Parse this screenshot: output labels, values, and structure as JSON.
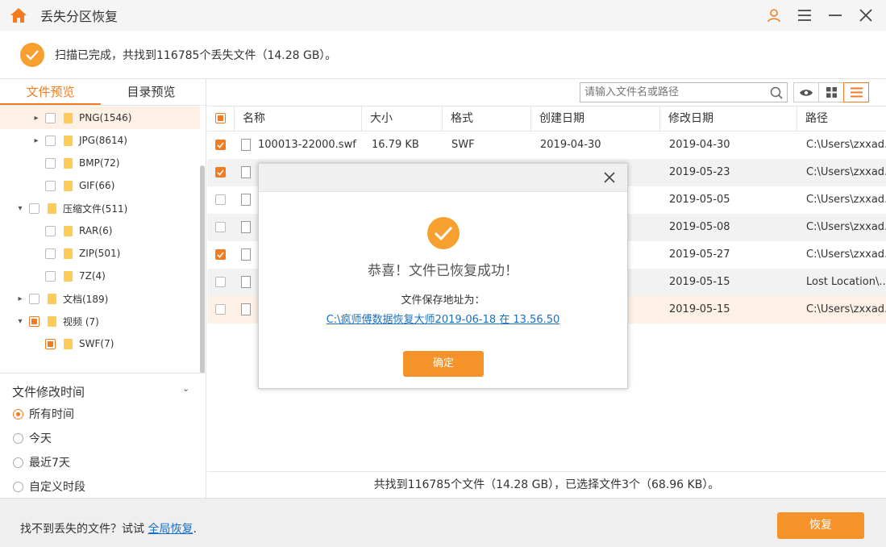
{
  "app": {
    "title": "丢失分区恢复"
  },
  "status": {
    "message": "扫描已完成，共找到116785个丢失文件（14.28 GB）。"
  },
  "left": {
    "tabs": [
      "文件预览",
      "目录预览"
    ],
    "tree": [
      {
        "label": "PNG(1546)"
      },
      {
        "label": "JPG(8614)"
      },
      {
        "label": "BMP(72)"
      },
      {
        "label": "GIF(66)"
      },
      {
        "label": "压缩文件(511)"
      },
      {
        "label": "RAR(6)"
      },
      {
        "label": "ZIP(501)"
      },
      {
        "label": "7Z(4)"
      },
      {
        "label": "文档(189)"
      },
      {
        "label": "视频 (7)"
      },
      {
        "label": "SWF(7)"
      }
    ],
    "filter": {
      "title": "文件修改时间",
      "options": [
        "所有时间",
        "今天",
        "最近7天",
        "自定义时段"
      ],
      "selected": "所有时间"
    }
  },
  "search": {
    "placeholder": "请输入文件名或路径"
  },
  "table": {
    "headers": [
      "名称",
      "大小",
      "格式",
      "创建日期",
      "修改日期",
      "路径"
    ],
    "rows": [
      {
        "name": "100013-22000.swf",
        "size": "16.79 KB",
        "format": "SWF",
        "created": "2019-04-30",
        "modified": "2019-04-30",
        "path": "C:\\Users\\zxxad...",
        "checked": true
      },
      {
        "name": "",
        "size": "",
        "format": "",
        "created": "",
        "modified": "2019-05-23",
        "path": "C:\\Users\\zxxad...",
        "checked": true
      },
      {
        "name": "",
        "size": "",
        "format": "",
        "created": "",
        "modified": "2019-05-05",
        "path": "C:\\Users\\zxxad...",
        "checked": false
      },
      {
        "name": "",
        "size": "",
        "format": "",
        "created": "",
        "modified": "2019-05-08",
        "path": "C:\\Users\\zxxad...",
        "checked": false
      },
      {
        "name": "",
        "size": "",
        "format": "",
        "created": "",
        "modified": "2019-05-27",
        "path": "C:\\Users\\zxxad...",
        "checked": true
      },
      {
        "name": "",
        "size": "",
        "format": "",
        "created": "",
        "modified": "2019-05-15",
        "path": "Lost Location\\...",
        "checked": false
      },
      {
        "name": "",
        "size": "",
        "format": "",
        "created": "",
        "modified": "2019-05-15",
        "path": "C:\\Users\\zxxad...",
        "checked": false
      }
    ],
    "footer": "共找到116785个文件（14.28 GB），已选择文件3个（68.96 KB）。"
  },
  "bottom": {
    "hint_prefix": "找不到丢失的文件？试试 ",
    "hint_link": "全局恢复",
    "hint_suffix": ".",
    "recover_label": "恢复"
  },
  "modal": {
    "congrats": "恭喜！文件已恢复成功！",
    "path_label": "文件保存地址为：",
    "path_link": "C:\\疯师傅数据恢复大师2019-06-18 在 13.56.50",
    "ok_label": "确定"
  },
  "colors": {
    "accent": "#f47b20",
    "button": "#f5932a",
    "link": "#1a6fc0"
  }
}
